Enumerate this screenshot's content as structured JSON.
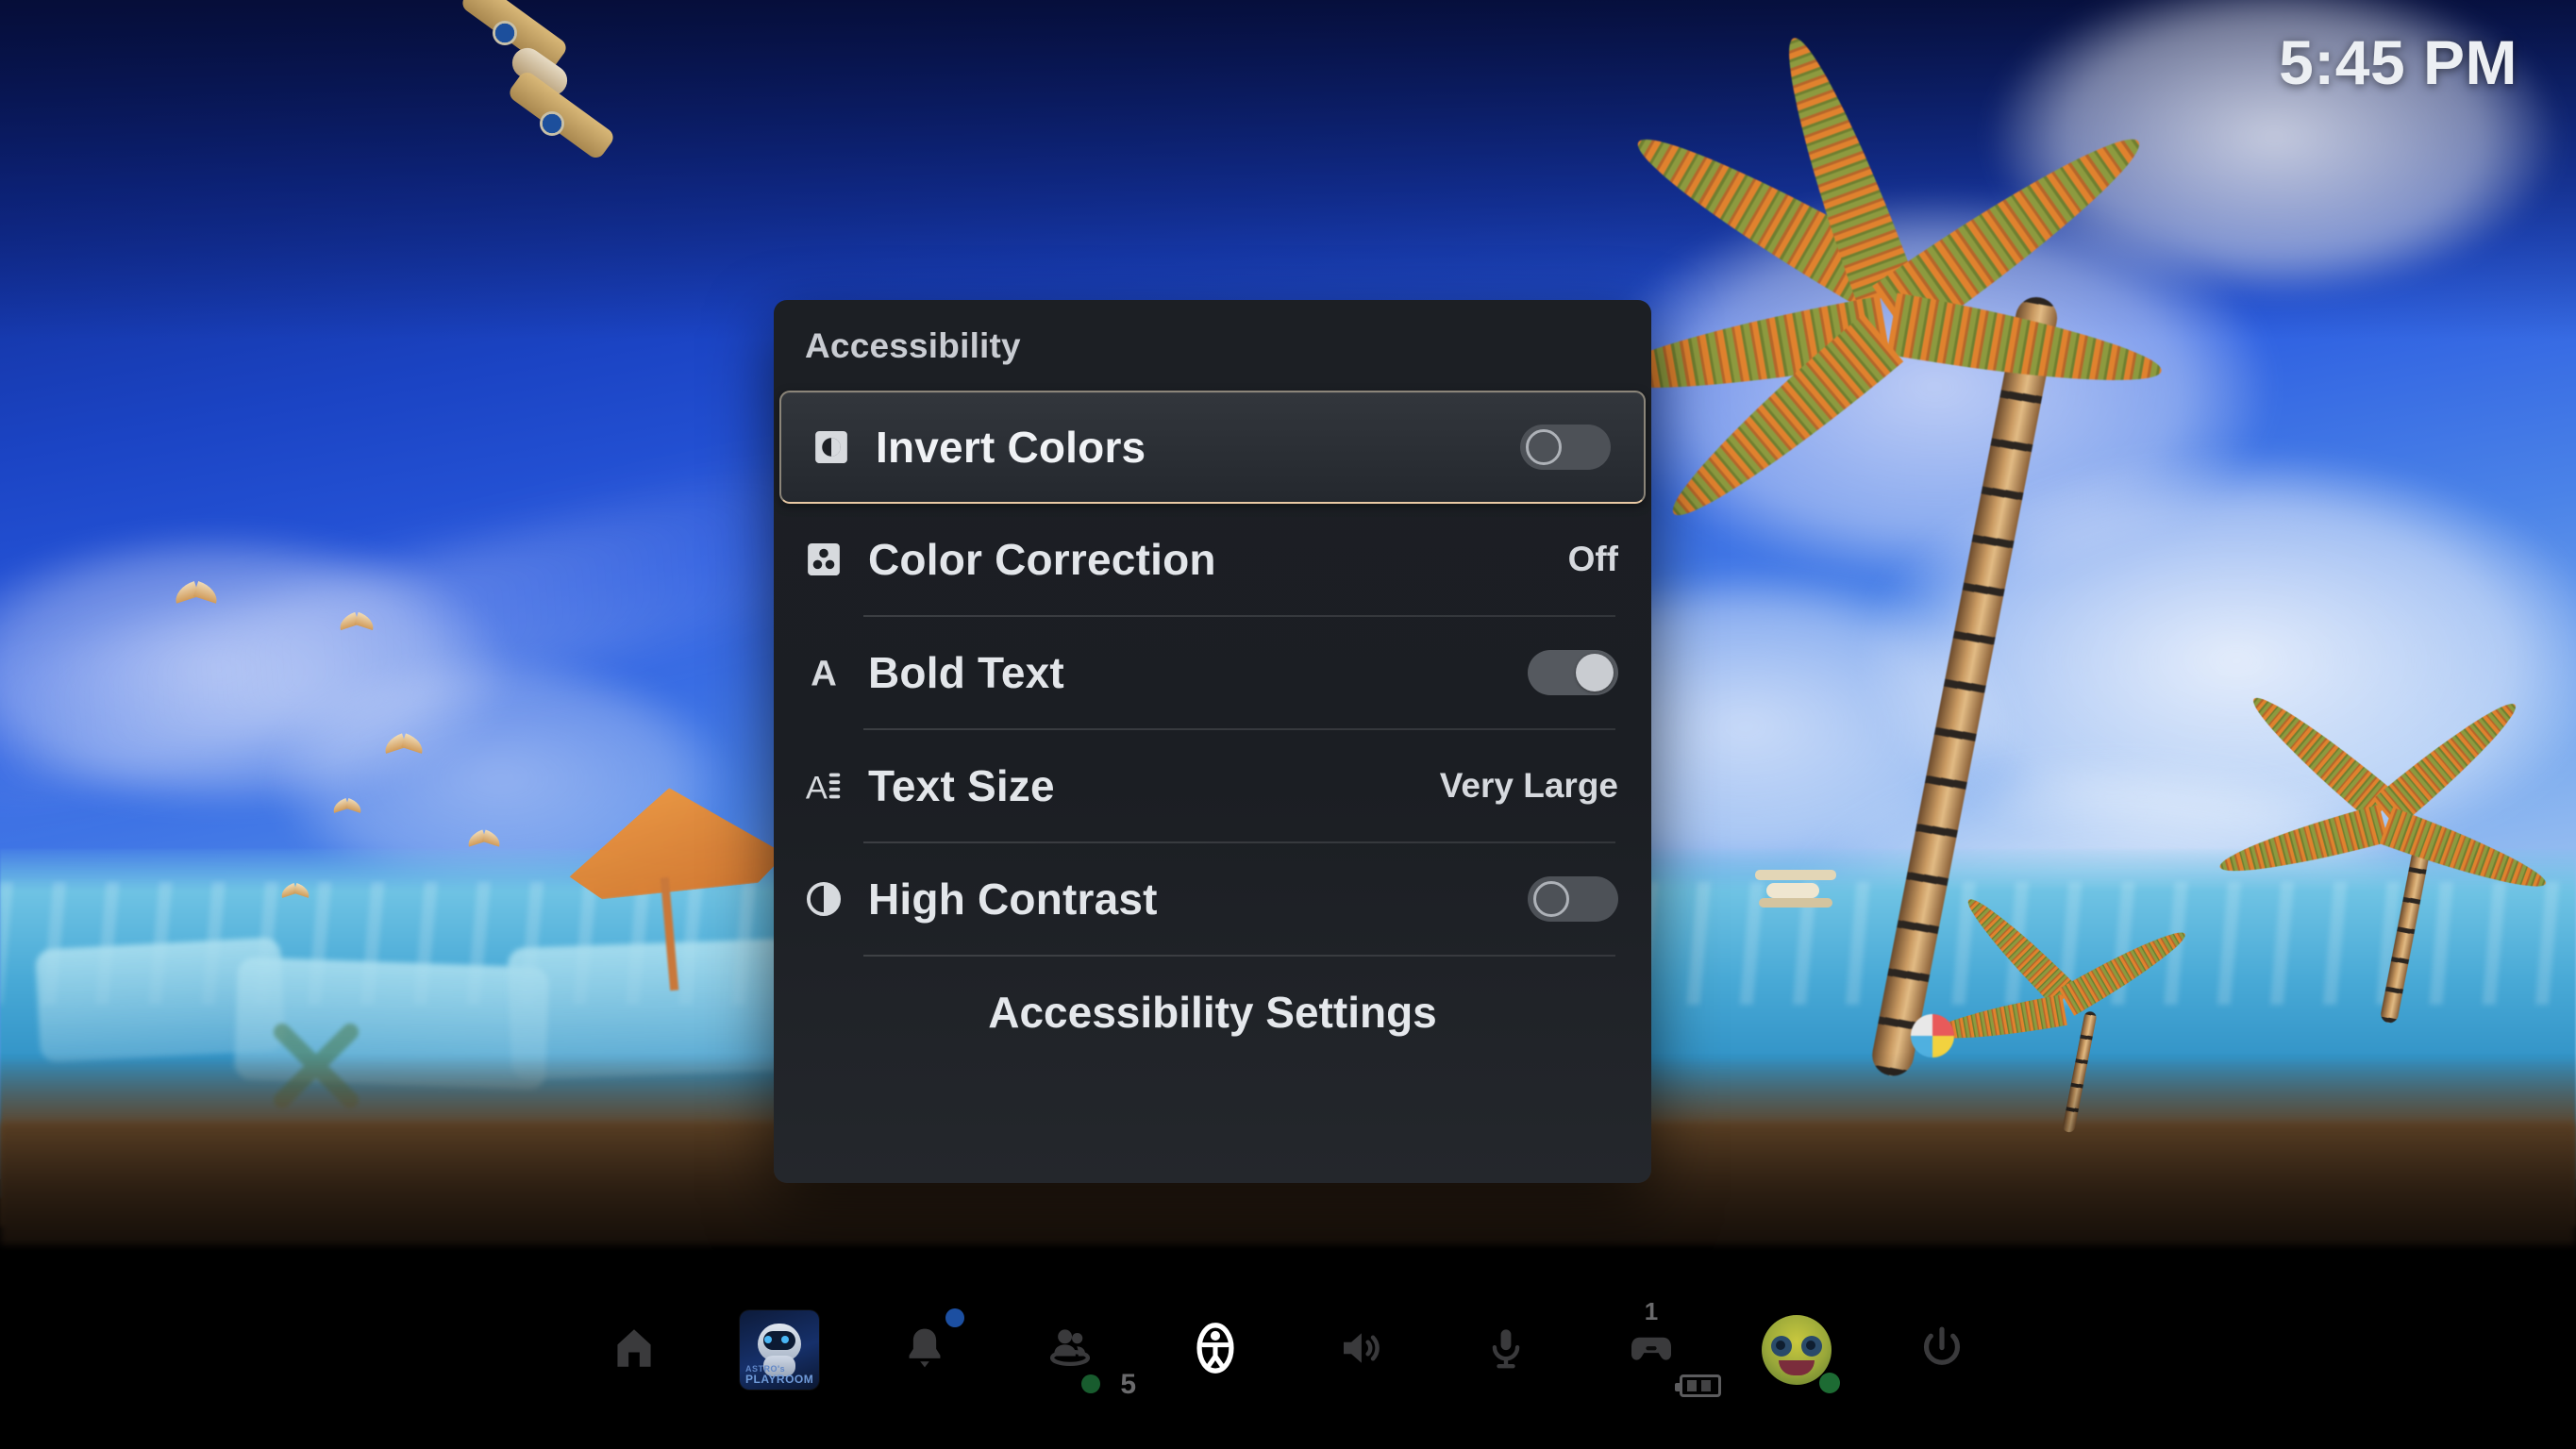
{
  "status_bar": {
    "clock": "5:45 PM"
  },
  "panel": {
    "title": "Accessibility",
    "items": [
      {
        "label": "Invert Colors",
        "icon": "invert-colors-icon",
        "control": "toggle",
        "state": "off",
        "value": "",
        "selected": true
      },
      {
        "label": "Color Correction",
        "icon": "color-correction-icon",
        "control": "value",
        "state": "",
        "value": "Off",
        "selected": false
      },
      {
        "label": "Bold Text",
        "icon": "bold-text-icon",
        "control": "toggle",
        "state": "on",
        "value": "",
        "selected": false
      },
      {
        "label": "Text Size",
        "icon": "text-size-icon",
        "control": "value",
        "state": "",
        "value": "Very Large",
        "selected": false
      },
      {
        "label": "High Contrast",
        "icon": "high-contrast-icon",
        "control": "toggle",
        "state": "off",
        "value": "",
        "selected": false
      }
    ],
    "footer_label": "Accessibility Settings"
  },
  "control_center": {
    "items": [
      {
        "name": "home",
        "icon": "home-icon",
        "label": "Home"
      },
      {
        "name": "game-card",
        "icon": "game-card-icon",
        "label": "ASTRO'S PLAYROOM",
        "title_line1": "ASTRO's",
        "title_line2": "PLAYROOM"
      },
      {
        "name": "notifications",
        "icon": "bell-icon",
        "label": "Notifications",
        "badge": "new"
      },
      {
        "name": "friends",
        "icon": "friends-icon",
        "label": "Friends",
        "count": "5"
      },
      {
        "name": "accessibility",
        "icon": "accessibility-icon",
        "label": "Accessibility",
        "active": true
      },
      {
        "name": "sound",
        "icon": "speaker-icon",
        "label": "Sound"
      },
      {
        "name": "microphone",
        "icon": "microphone-icon",
        "label": "Microphone"
      },
      {
        "name": "controller",
        "icon": "controller-icon",
        "label": "Controller",
        "number": "1",
        "battery": "2"
      },
      {
        "name": "profile",
        "icon": "avatar-icon",
        "label": "Profile"
      },
      {
        "name": "power",
        "icon": "power-icon",
        "label": "Power"
      }
    ]
  },
  "colors": {
    "panel_bg": "#1c1f24",
    "selected_border": "#e9c9a4",
    "text_primary": "#e3e6ea",
    "text_secondary": "#c9ccd2",
    "toggle_track": "#55595f",
    "accent_blue": "#1c4fa1",
    "status_green": "#185c2e"
  }
}
